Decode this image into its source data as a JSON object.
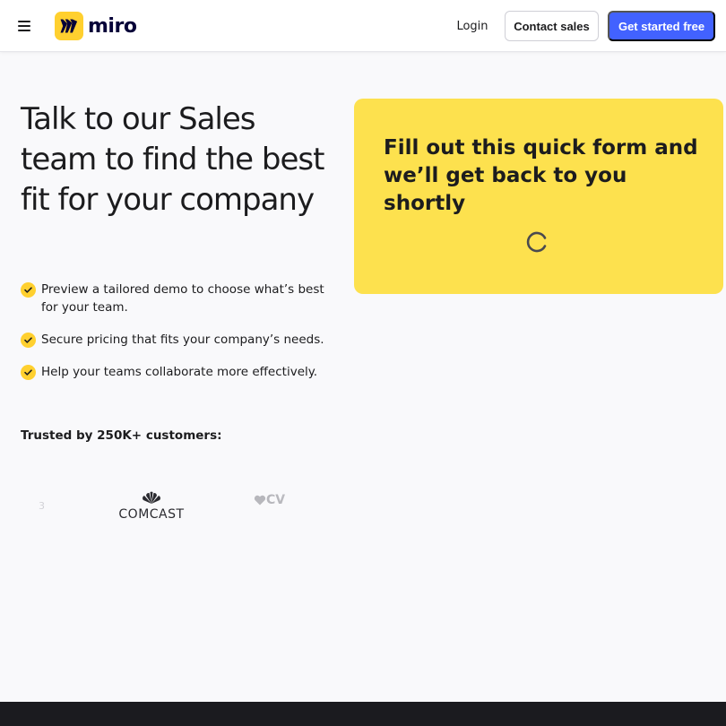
{
  "header": {
    "logo_text": "miro",
    "nav": {
      "login": "Login",
      "contact_sales": "Contact sales",
      "get_started": "Get started free"
    }
  },
  "hero": {
    "headline": "Talk to our Sales team to find the best fit for your company",
    "benefits": [
      "Preview a tailored demo to choose what’s best for your team.",
      "Secure pricing that fits your company’s needs.",
      "Help your teams collaborate more effectively."
    ],
    "trusted_label": "Trusted by 250K+ customers:",
    "customer_logos": {
      "fragment": "3",
      "comcast": "COMCAST",
      "cvs": "CV"
    }
  },
  "form_card": {
    "title": "Fill out this quick form and we’ll get back to you shortly"
  },
  "colors": {
    "brand_yellow": "#ffd02f",
    "card_yellow": "#fde14e",
    "primary_blue": "#4262ff",
    "text": "#1c1c1e",
    "footer": "#1b1b1f"
  }
}
